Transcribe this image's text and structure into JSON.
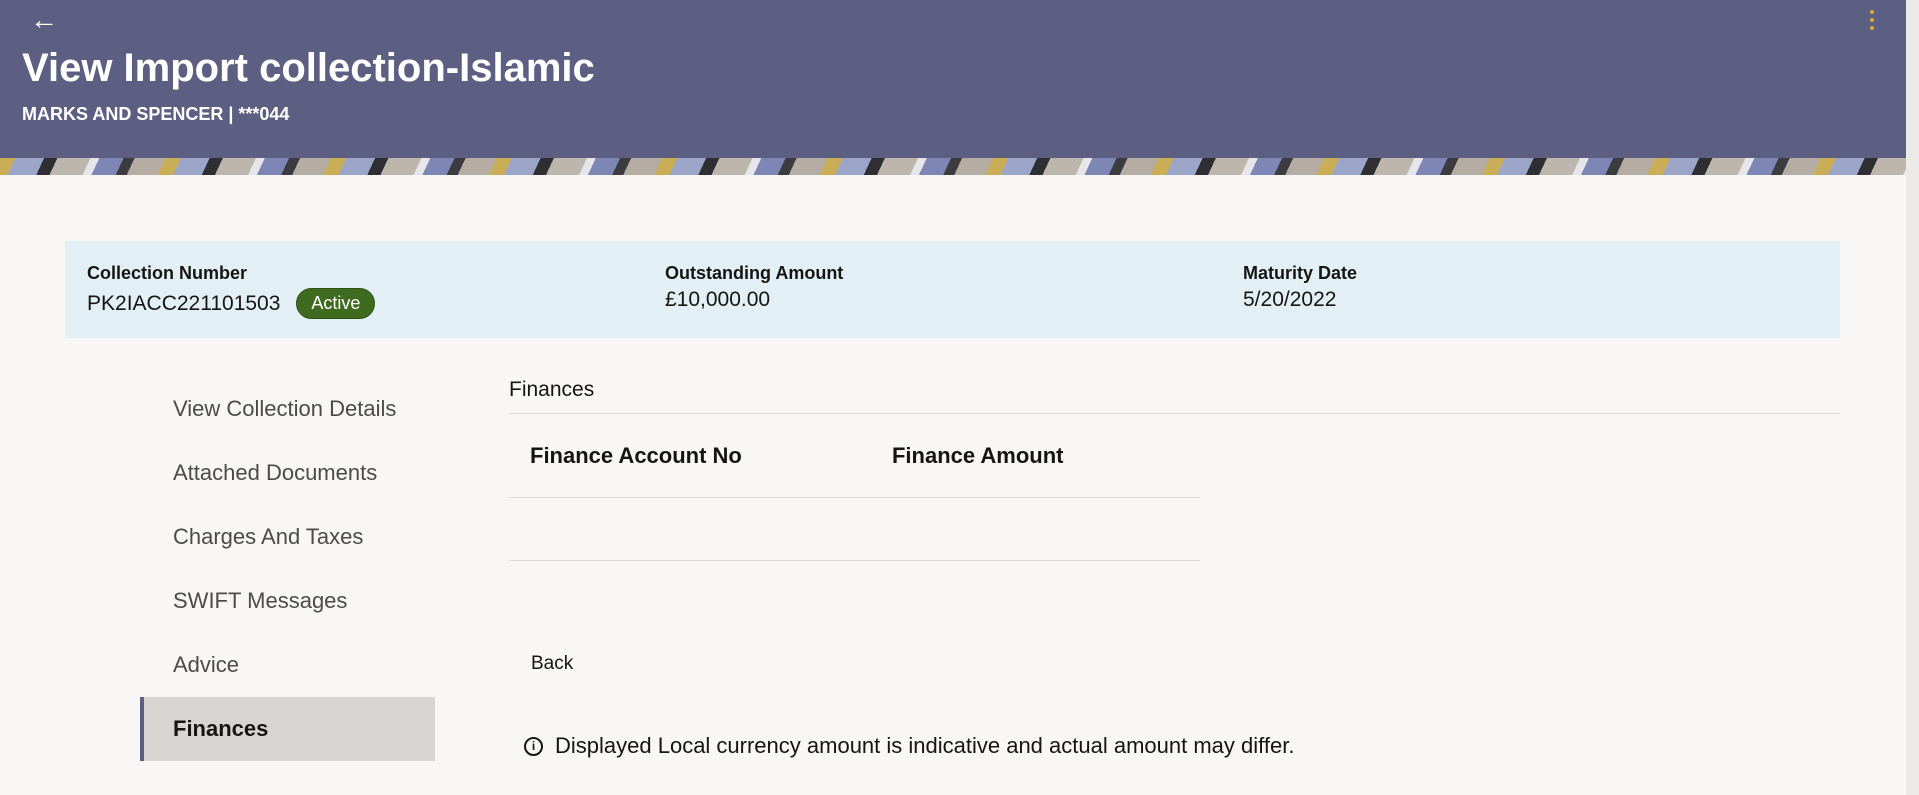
{
  "header": {
    "title": "View Import collection-Islamic",
    "subtitle": "MARKS AND SPENCER | ***044",
    "back_icon": "←",
    "menu_icon": "kebab-menu-icon"
  },
  "summary": {
    "collection_number_label": "Collection Number",
    "collection_number": "PK2IACC221101503",
    "status": "Active",
    "outstanding_amount_label": "Outstanding Amount",
    "outstanding_amount": "£10,000.00",
    "maturity_date_label": "Maturity Date",
    "maturity_date": "5/20/2022"
  },
  "sidebar": {
    "items": [
      {
        "label": "View Collection Details"
      },
      {
        "label": "Attached Documents"
      },
      {
        "label": "Charges And Taxes"
      },
      {
        "label": "SWIFT Messages"
      },
      {
        "label": "Advice"
      },
      {
        "label": "Finances",
        "active": true
      }
    ]
  },
  "main": {
    "section_title": "Finances",
    "columns": [
      "Finance Account No",
      "Finance Amount"
    ],
    "rows": [],
    "back_label": "Back",
    "info_icon": "i",
    "info_text": "Displayed Local currency amount is indicative and actual amount may differ."
  },
  "colors": {
    "header_bg": "#5c5f82",
    "summary_bg": "#e2eff5",
    "status_badge": "#3e6b1f",
    "active_nav_bg": "#d8d4d1"
  }
}
